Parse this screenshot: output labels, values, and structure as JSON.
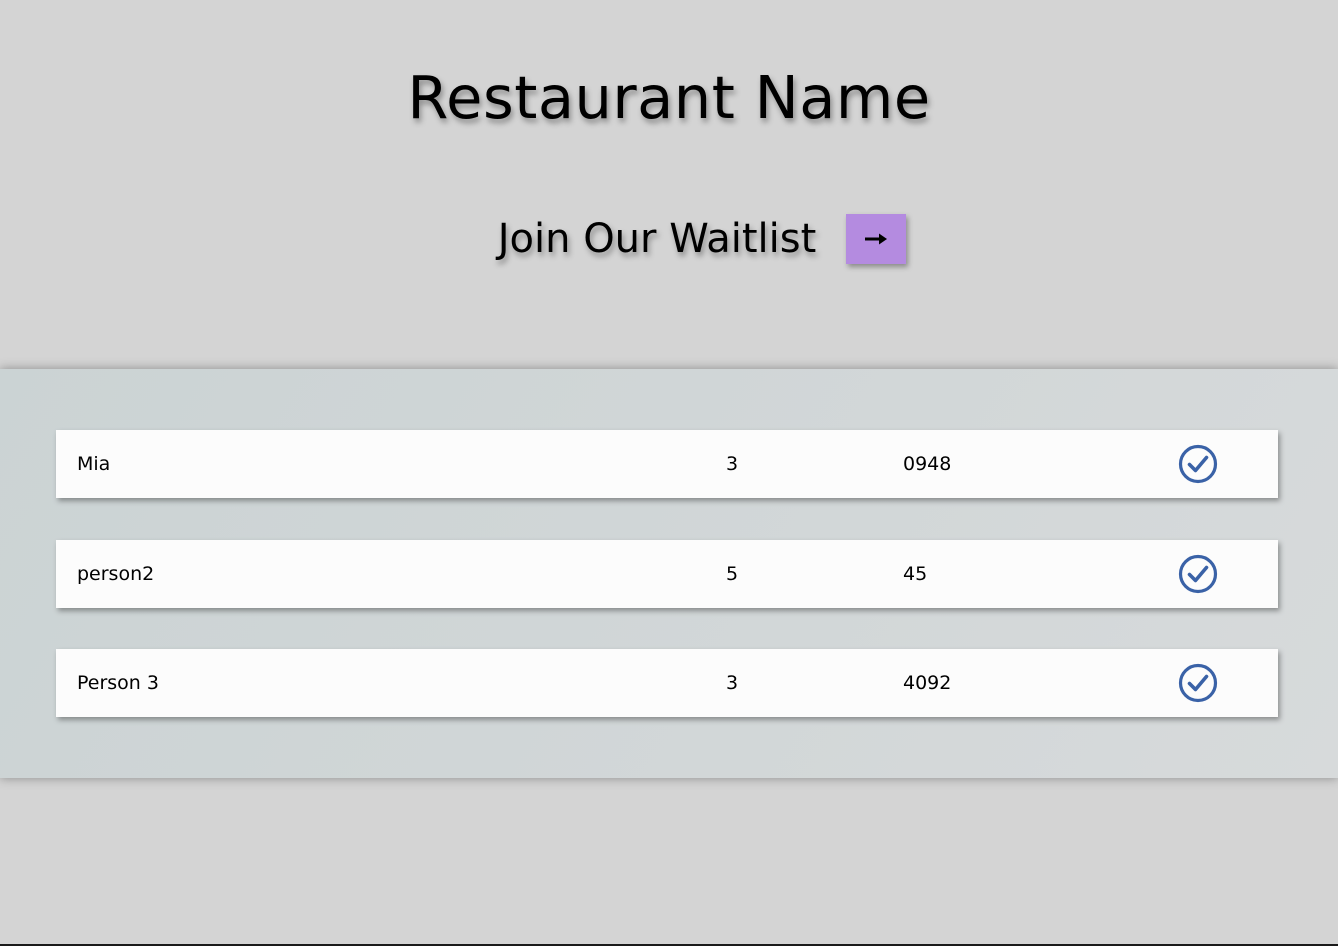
{
  "header": {
    "title": "Restaurant Name",
    "join_label": "Join Our Waitlist",
    "join_button_icon": "arrow-right-icon"
  },
  "waitlist": {
    "rows": [
      {
        "name": "Mia",
        "party_size": "3",
        "code": "0948",
        "action_icon": "check-circle-icon"
      },
      {
        "name": "person2",
        "party_size": "5",
        "code": "45",
        "action_icon": "check-circle-icon"
      },
      {
        "name": "Person 3",
        "party_size": "3",
        "code": "4092",
        "action_icon": "check-circle-icon"
      }
    ]
  },
  "colors": {
    "page_background": "#d4d4d4",
    "join_button": "#b48be0",
    "check_icon": "#3a62a7",
    "row_background": "#fcfcfc"
  }
}
